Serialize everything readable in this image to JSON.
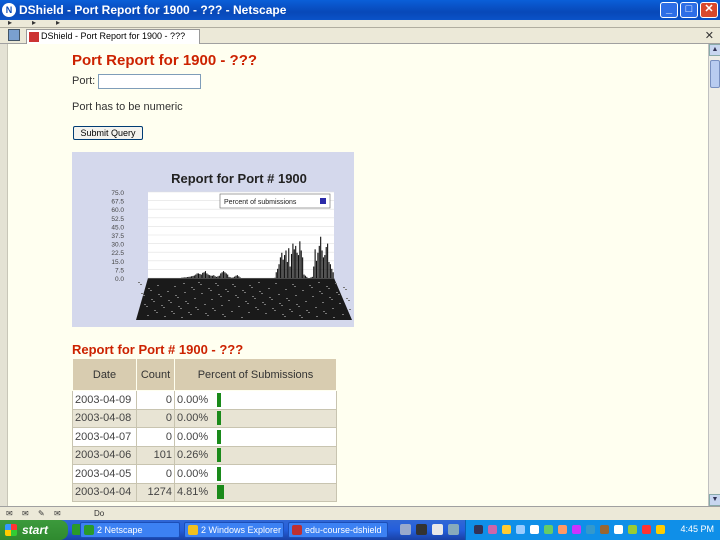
{
  "window": {
    "title": "DShield - Port Report for 1900 - ??? - Netscape",
    "buttons": {
      "minimize": "_",
      "maximize": "□",
      "close": "✕"
    }
  },
  "tab": {
    "label": "DShield - Port Report for 1900 - ???",
    "close": "✕"
  },
  "page": {
    "heading": "Port Report for 1900 - ???",
    "port_label": "Port:",
    "port_value": "",
    "help_text": "Port has to be numeric",
    "submit_label": "Submit Query",
    "section_heading": "Report for Port # 1900 - ???"
  },
  "chart_data": {
    "type": "bar",
    "title": "Report for Port # 1900",
    "legend": "Percent of submissions",
    "legend_position": "top-right",
    "y_ticks": [
      "75.0",
      "67.5",
      "60.0",
      "52.5",
      "45.0",
      "37.5",
      "30.0",
      "22.5",
      "15.0",
      "7.5",
      "0.0"
    ],
    "ylim": [
      0,
      75
    ],
    "grid": true,
    "series": [
      {
        "name": "Percent of submissions",
        "values": [
          0,
          0,
          0,
          0,
          0,
          0,
          0,
          0,
          0,
          0,
          0,
          0,
          0,
          0,
          0,
          0,
          0,
          0,
          0,
          0,
          0,
          0,
          0,
          0,
          0.3,
          0.4,
          0.5,
          0.6,
          0.8,
          1,
          1.2,
          1.5,
          1.8,
          2.2,
          3,
          4,
          4,
          3.5,
          3,
          4.5,
          5,
          6,
          4,
          3,
          2.5,
          2,
          2,
          2.5,
          1.5,
          1,
          1.5,
          2,
          4,
          5,
          6,
          5,
          4,
          3,
          1,
          0.5,
          0.3,
          0.5,
          1.2,
          2,
          2.5,
          1.5,
          0.5,
          0,
          0,
          0,
          0,
          0,
          0,
          0,
          0,
          0,
          0,
          0,
          0,
          0,
          0,
          0,
          0,
          0,
          0,
          0,
          0,
          0,
          0,
          0,
          0,
          0.2,
          5,
          8,
          12,
          18,
          22,
          16,
          20,
          24,
          14,
          26,
          10,
          21,
          30,
          25,
          28,
          22,
          20,
          32,
          24,
          18,
          3,
          2,
          1,
          0,
          0,
          0.5,
          1,
          10,
          25,
          15,
          22,
          28,
          36,
          24,
          18,
          20,
          27,
          30,
          14,
          12,
          8,
          5
        ]
      }
    ]
  },
  "table": {
    "headers": [
      "Date",
      "Count",
      "Percent of Submissions"
    ],
    "rows": [
      {
        "date": "2003-04-09",
        "count": "0",
        "pct": "0.00%",
        "pct_value": 0.0
      },
      {
        "date": "2003-04-08",
        "count": "0",
        "pct": "0.00%",
        "pct_value": 0.0
      },
      {
        "date": "2003-04-07",
        "count": "0",
        "pct": "0.00%",
        "pct_value": 0.0
      },
      {
        "date": "2003-04-06",
        "count": "101",
        "pct": "0.26%",
        "pct_value": 0.26
      },
      {
        "date": "2003-04-05",
        "count": "0",
        "pct": "0.00%",
        "pct_value": 0.0
      },
      {
        "date": "2003-04-04",
        "count": "1274",
        "pct": "4.81%",
        "pct_value": 4.81
      }
    ]
  },
  "statusbar": {
    "text": "Do"
  },
  "taskbar": {
    "start_label": "start",
    "tasks": [
      {
        "label": "2 Netscape",
        "color": "#2a9a2a"
      },
      {
        "label": "2 Windows Explorer",
        "color": "#f0c020"
      },
      {
        "label": "edu-course-dshield",
        "color": "#c03030"
      }
    ],
    "clock": "4:45 PM"
  },
  "colors": {
    "heading": "#cc2200",
    "chart_bg": "#d4d8ec",
    "table_header": "#d8ccb0",
    "bar": "#1a8a1a"
  }
}
